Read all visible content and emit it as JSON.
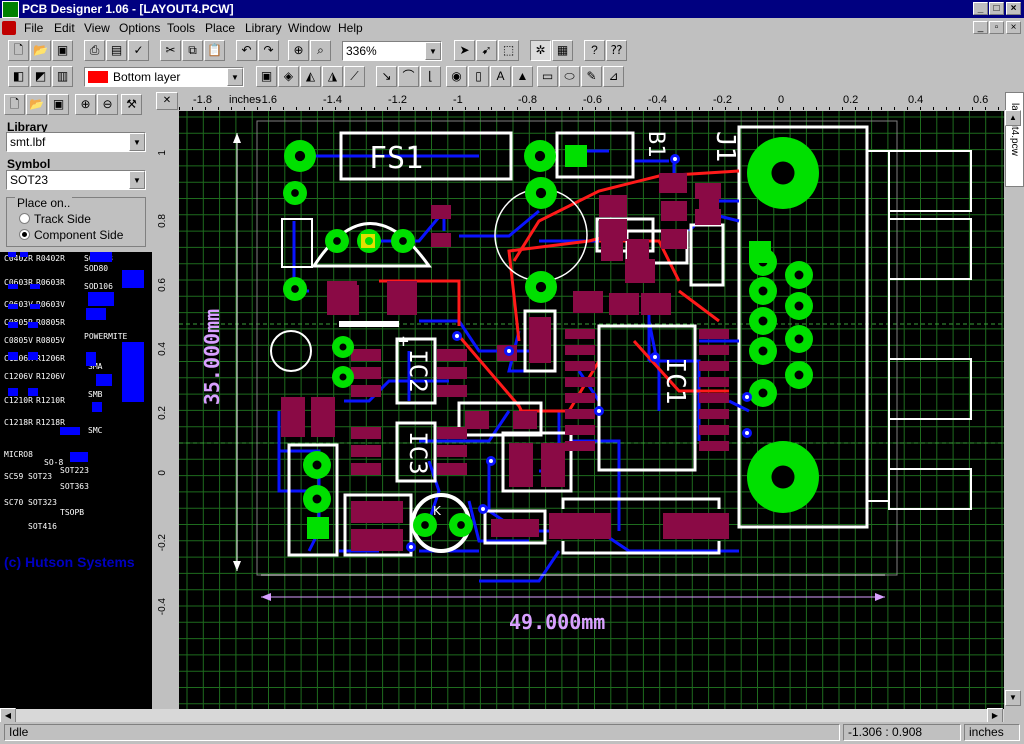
{
  "window": {
    "title": "PCB Designer 1.06 - [LAYOUT4.PCW]",
    "min": "_",
    "max": "□",
    "close": "×"
  },
  "menus": [
    "File",
    "Edit",
    "View",
    "Options",
    "Tools",
    "Place",
    "Library",
    "Window",
    "Help"
  ],
  "toolbar1": {
    "zoom": "336%"
  },
  "toolbar2": {
    "layer": "Bottom layer",
    "layer_color": "#ff0000",
    "text_tool": "A"
  },
  "left_panel": {
    "library_label": "Library",
    "library_value": "smt.lbf",
    "symbol_label": "Symbol",
    "symbol_value": "SOT23",
    "place_on_label": "Place on..",
    "radio_track": "Track Side",
    "radio_component": "Component Side",
    "selected_place": "component",
    "library_symbols": [
      "C0402R",
      "R0402R",
      "SOD123",
      "C0603R",
      "R0603R",
      "SOD80",
      "DPAK",
      "C0603V",
      "R0603V",
      "SOD106",
      "C0805R",
      "R0805R",
      "POWERMITE",
      "C0805V",
      "R0805V",
      "C1206R",
      "R1206R",
      "SMA",
      "C1206V",
      "R1206V",
      "SMB",
      "C1210R",
      "R1210R",
      "C1218R",
      "R1218R",
      "SMC",
      "MICRO8",
      "SO-8",
      "SC59",
      "SOT23",
      "SOT223",
      "SOT363",
      "SC70",
      "SOT323",
      "TSOPB",
      "SOT416"
    ],
    "copyright": "(c) Hutson Systems"
  },
  "ruler": {
    "units": "inches",
    "x_ticks": [
      "-1.8",
      "-1.6",
      "-1.4",
      "-1.2",
      "-1",
      "-0.8",
      "-0.6",
      "-0.4",
      "-0.2",
      "0",
      "0.2",
      "0.4",
      "0.6"
    ],
    "y_ticks": [
      "1",
      "0.8",
      "0.6",
      "0.4",
      "0.2",
      "0",
      "-0.2",
      "-0.4"
    ]
  },
  "board": {
    "width_dim": "49.000mm",
    "height_dim": "35.000mm",
    "labels": {
      "fs1": "FS1",
      "b1": "B1",
      "j1": "J1",
      "ic1": "IC1",
      "ic2": "IC2",
      "ic3": "IC3",
      "k": "K",
      "plus": "+"
    },
    "colors": {
      "bottom_track": "#0a14ff",
      "top_track": "#ff1a1a",
      "pad_green": "#00e000",
      "smd_pad": "#8a0a45",
      "silkscreen": "#ffffff",
      "dimension": "#d8a0ff",
      "grid": "#1e6b1e"
    }
  },
  "doc_tab": "layout4.pcw",
  "status": {
    "message": "Idle",
    "coords": "-1.306 : 0.908",
    "units": "inches"
  }
}
